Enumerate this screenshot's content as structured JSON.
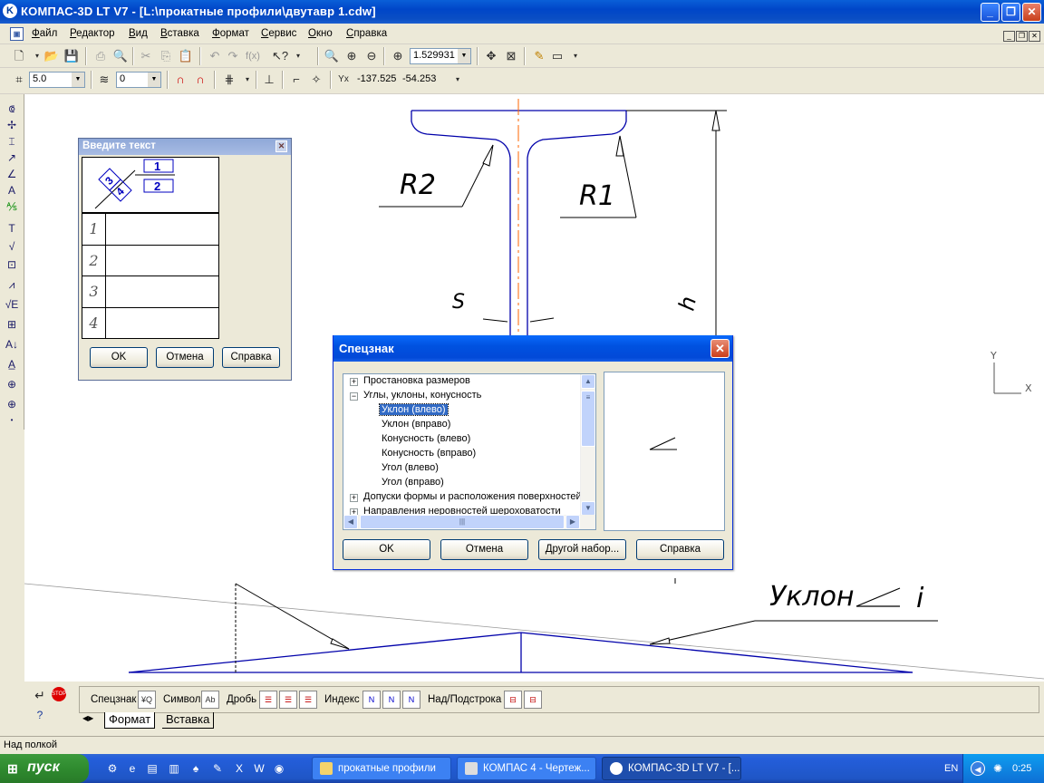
{
  "window": {
    "title": "КОМПАС-3D LT V7 - [L:\\прокатные профили\\двутавр 1.cdw]"
  },
  "menu": [
    "Файл",
    "Редактор",
    "Вид",
    "Вставка",
    "Формат",
    "Сервис",
    "Окно",
    "Справка"
  ],
  "toolbar1": {
    "zoom": "1.529931"
  },
  "toolbar2": {
    "step": "5.0",
    "layer": "0",
    "coord_x": "-137.525",
    "coord_y": "-54.253"
  },
  "drawing": {
    "label_r2": "R2",
    "label_r1": "R1",
    "label_s": "S",
    "label_h": "h",
    "label_slope": "Уклон",
    "label_i": "i",
    "axis_y": "Y",
    "axis_x": "X"
  },
  "dialog_text": {
    "title": "Введите текст",
    "frac_top": "1",
    "frac_bottom": "2",
    "frac_3": "3",
    "frac_4": "4",
    "rows": [
      "1",
      "2",
      "3",
      "4"
    ],
    "ok": "OK",
    "cancel": "Отмена",
    "help": "Справка"
  },
  "dialog_spec": {
    "title": "Спецзнак",
    "tree": {
      "item0": "Простановка размеров",
      "item1": "Углы, уклоны, конусность",
      "child0": "Уклон (влево)",
      "child1": "Уклон (вправо)",
      "child2": "Конусность (влево)",
      "child3": "Конусность (вправо)",
      "child4": "Угол (влево)",
      "child5": "Угол (вправо)",
      "item2": "Допуски формы и расположения поверхностей",
      "item3": "Направления неровностей шероховатости"
    },
    "ok": "OK",
    "cancel": "Отмена",
    "other": "Другой набор...",
    "help": "Справка"
  },
  "bottom_panel": {
    "specsign": "Спецзнак",
    "symbol": "Символ",
    "fraction": "Дробь",
    "index": "Индекс",
    "superscript": "Над/Подстрока",
    "tab_format": "Формат",
    "tab_insert": "Вставка"
  },
  "status": {
    "text": "Над полкой"
  },
  "taskbar": {
    "start": "пуск",
    "tasks": [
      "прокатные профили",
      "КОМПАС 4 - Чертеж...",
      "КОМПАС-3D LT V7 - [..."
    ],
    "lang": "EN",
    "clock": "0:25"
  },
  "colors": {
    "titlebar": "#0a4ec4",
    "drawing_line": "#0000aa",
    "axis_line": "#ff6600",
    "selection": "#316ac5"
  }
}
